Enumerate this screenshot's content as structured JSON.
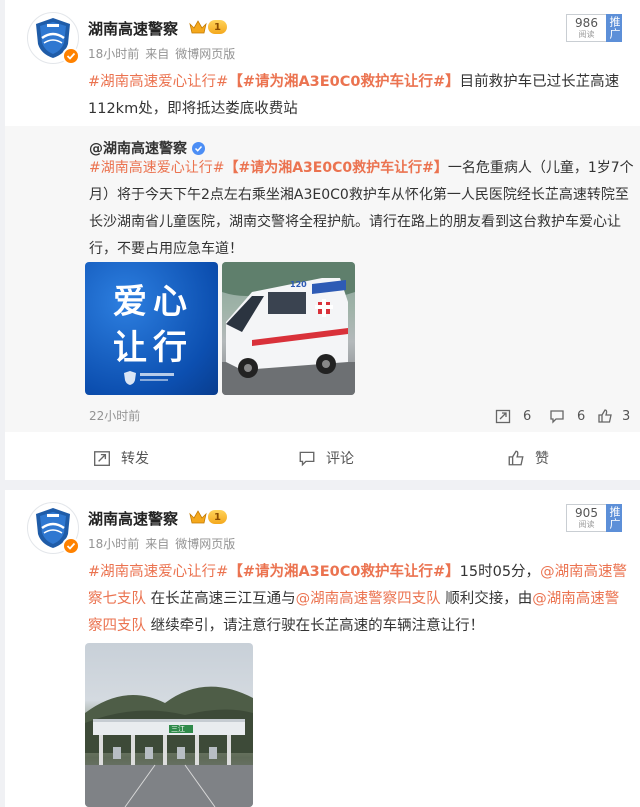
{
  "post1": {
    "author": "湖南高速警察",
    "vip_level": "1",
    "time": "18小时前",
    "source_prefix": "来自",
    "source": "微博网页版",
    "reads": "986",
    "reads_label": "阅读",
    "push_label": "推广",
    "text": {
      "tag1": "#湖南高速爱心让行#",
      "tag2": "【#请为湘A3E0C0救护车让行#】",
      "body": "目前救护车已过长芷高速112km处，即将抵达娄底收费站"
    },
    "repost": {
      "author": "@湖南高速警察",
      "tag1": "#湖南高速爱心让行#",
      "tag2": "【#请为湘A3E0C0救护车让行#】",
      "body": "一名危重病人（儿童，1岁7个月）将于今天下午2点左右乘坐湘A3E0C0救护车从怀化第一人民医院经长芷高速转院至长沙湖南省儿童医院，湖南交警将全程护航。请行在路上的朋友看到这台救护车爱心让行，不要占用应急车道！",
      "image1_text": [
        "爱心",
        "让行"
      ],
      "ambulance_label": "120",
      "time": "22小时前",
      "reposts": "6",
      "comments": "6",
      "likes": "3"
    },
    "actions": {
      "repost": "转发",
      "comment": "评论",
      "like": "赞"
    }
  },
  "post2": {
    "author": "湖南高速警察",
    "vip_level": "1",
    "time": "18小时前",
    "source_prefix": "来自",
    "source": "微博网页版",
    "reads": "905",
    "reads_label": "阅读",
    "push_label": "推广",
    "text": {
      "tag1": "#湖南高速爱心让行#",
      "tag2": "【#请为湘A3E0C0救护车让行#】",
      "part1": "15时05分，",
      "mention1": "@湖南高速警察七支队",
      "part2": "在长芷高速三江互通与",
      "mention2": "@湖南高速警察四支队",
      "part3": "顺利交接，由",
      "mention3": "@湖南高速警察四支队",
      "part4": "继续牵引，请注意行驶在长芷高速的车辆注意让行！"
    },
    "toll_sign": "三江"
  },
  "colors": {
    "accent": "#eb7350",
    "reads_push": "#5c8fd8",
    "badge": "#ff8200"
  },
  "icons": [
    "police-emblem-icon",
    "verified-icon",
    "crown-icon",
    "repost-icon",
    "comment-icon",
    "like-icon"
  ]
}
